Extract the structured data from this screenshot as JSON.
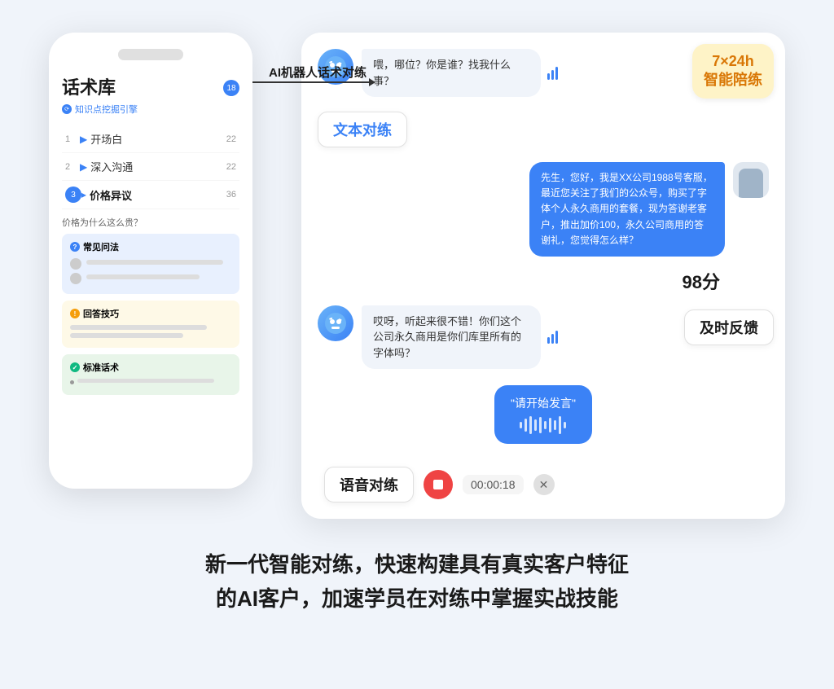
{
  "page": {
    "background": "#f0f4fa"
  },
  "phone": {
    "title": "话术库",
    "subtitle": "知识点挖掘引擎",
    "badge": "18",
    "menu": [
      {
        "num": "1",
        "arrow": "▶",
        "label": "开场白",
        "count": "22",
        "active": false
      },
      {
        "num": "2",
        "arrow": "▶",
        "label": "深入沟通",
        "count": "22",
        "active": false
      },
      {
        "num": "3",
        "arrow": "▸",
        "label": "价格异议",
        "count": "36",
        "active": true
      }
    ],
    "subsection_title": "价格为什么这么贵？",
    "sections": [
      {
        "type": "blue",
        "icon_text": "?",
        "title": "常见问法"
      },
      {
        "type": "yellow",
        "icon_text": "!",
        "title": "回答技巧"
      },
      {
        "type": "green",
        "icon_text": "✓",
        "title": "标准话术"
      }
    ]
  },
  "arrow": {
    "label": "AI机器人话术对练"
  },
  "chat": {
    "badge_724": "7×24h\n智能陪练",
    "text_practice_label": "文本对练",
    "score": "98分",
    "feedback_label": "及时反馈",
    "voice_label": "语音对练",
    "timer": "00:00:18",
    "messages": [
      {
        "type": "bot",
        "text": "喂，哪位？你是谁？找我什么事？",
        "has_sound": true
      },
      {
        "type": "user",
        "text": "先生，您好，我是XX公司1988号客服，最近您关注了我们的公众号，购买了字体个人永久商用的套餐，现为答谢老客户，推出加价100，永久公司商用的答谢礼，您觉得怎么样？"
      },
      {
        "type": "bot",
        "text": "哎呀，听起来很不错！你们这个公司永久商用是你们库里所有的字体吗？",
        "has_sound": true
      },
      {
        "type": "speak",
        "text": "\"请开始发言\""
      }
    ]
  },
  "bottom": {
    "text_line1": "新一代智能对练，快速构建具有真实客户特征",
    "text_line2": "的AI客户，加速学员在对练中掌握实战技能"
  }
}
